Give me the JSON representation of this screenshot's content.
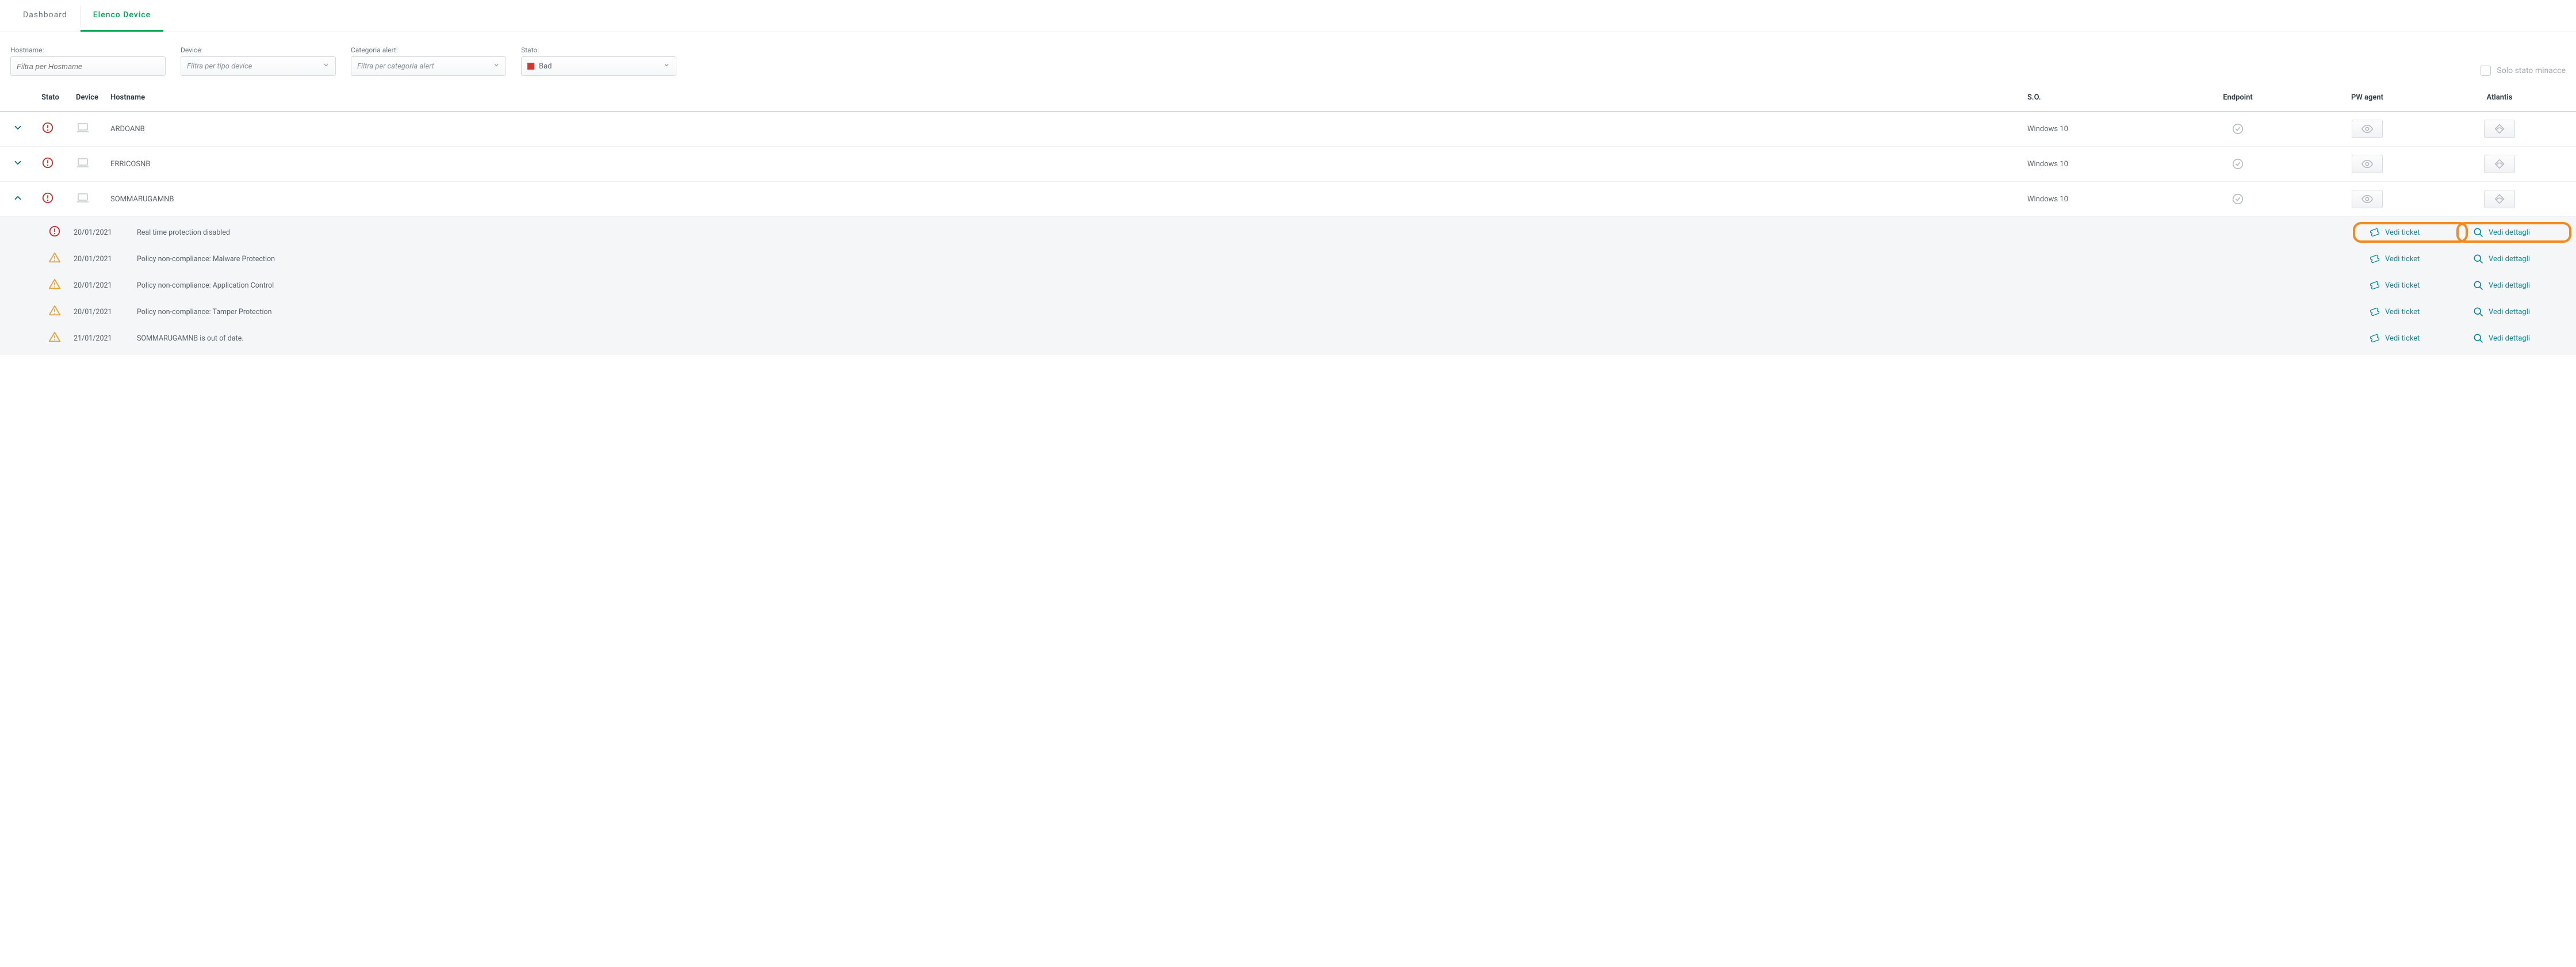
{
  "tabs": {
    "dashboard": "Dashboard",
    "elenco": "Elenco Device"
  },
  "filters": {
    "hostname_label": "Hostname:",
    "hostname_placeholder": "Filtra per Hostname",
    "device_label": "Device:",
    "device_placeholder": "Filtra per tipo device",
    "categoria_label": "Categoria alert:",
    "categoria_placeholder": "Filtra per categoria alert",
    "stato_label": "Stato:",
    "stato_value": "Bad",
    "solo_stato": "Solo stato minacce"
  },
  "headers": {
    "stato": "Stato",
    "device": "Device",
    "hostname": "Hostname",
    "so": "S.O.",
    "endpoint": "Endpoint",
    "pwagent": "PW agent",
    "atlantis": "Atlantis"
  },
  "rows": [
    {
      "hostname": "ARDOANB",
      "so": "Windows 10"
    },
    {
      "hostname": "ERRICOSNB",
      "so": "Windows 10"
    },
    {
      "hostname": "SOMMARUGAMNB",
      "so": "Windows 10"
    }
  ],
  "alerts": [
    {
      "sev": "err",
      "date": "20/01/2021",
      "msg": "Real time protection disabled"
    },
    {
      "sev": "warn",
      "date": "20/01/2021",
      "msg": "Policy non-compliance: Malware Protection"
    },
    {
      "sev": "warn",
      "date": "20/01/2021",
      "msg": "Policy non-compliance: Application Control"
    },
    {
      "sev": "warn",
      "date": "20/01/2021",
      "msg": "Policy non-compliance: Tamper Protection"
    },
    {
      "sev": "warn",
      "date": "21/01/2021",
      "msg": "SOMMARUGAMNB is out of date."
    }
  ],
  "actions": {
    "vedi_ticket": "Vedi ticket",
    "vedi_dettagli": "Vedi dettagli"
  }
}
